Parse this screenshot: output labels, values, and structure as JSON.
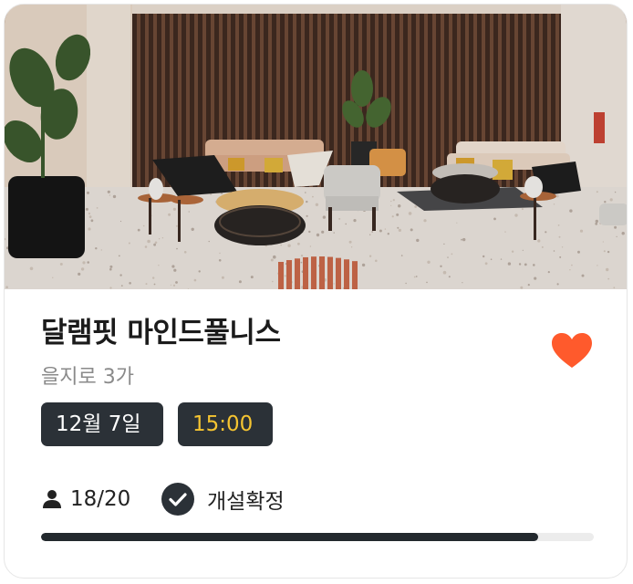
{
  "card": {
    "image": {
      "description_icon": "lobby-photo"
    },
    "title": "달램핏 마인드풀니스",
    "location": "을지로 3가",
    "date_chip": "12월 7일",
    "time_chip": "15:00",
    "participants": "18/20",
    "participants_current": 18,
    "participants_max": 20,
    "status_label": "개설확정",
    "favorite": true,
    "progress_fraction": 0.9
  },
  "colors": {
    "accent_heart": "#ff5a2c",
    "chip_bg": "#2b3137",
    "time_text": "#f5c431",
    "progress_fill": "#23292e",
    "progress_track": "#ececec"
  },
  "icons": {
    "favorite": "heart-icon",
    "participants": "person-icon",
    "status": "check-circle-icon"
  }
}
